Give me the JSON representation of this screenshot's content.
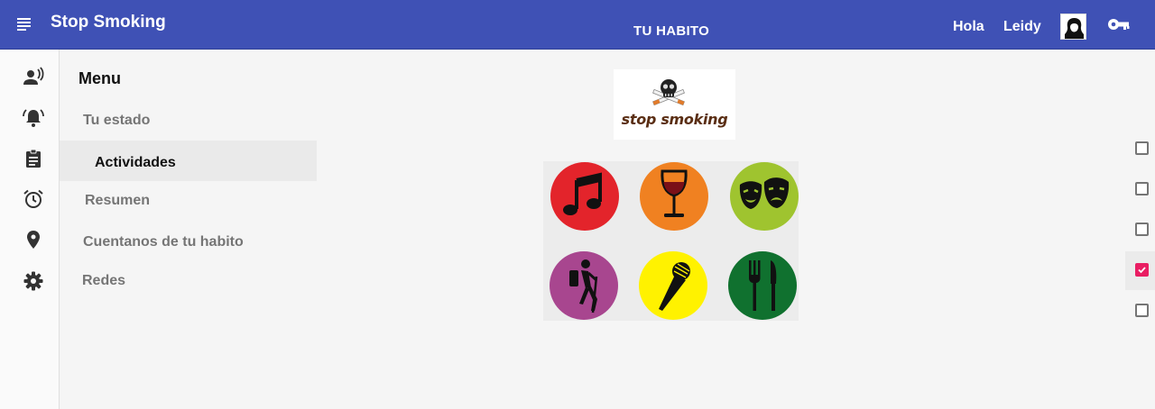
{
  "header": {
    "app_title": "Stop Smoking",
    "page_title": "TU HABITO",
    "greeting": "Hola",
    "user_name": "Leidy",
    "bar_color": "#3f51b5"
  },
  "rail": {
    "icons": [
      "person-voice-icon",
      "alarm-bell-icon",
      "clipboard-icon",
      "alarm-clock-icon",
      "location-pin-icon",
      "settings-gear-icon"
    ]
  },
  "sidebar": {
    "heading": "Menu",
    "items": [
      {
        "label": "Tu estado",
        "active": false
      },
      {
        "label": "Actividades",
        "active": true
      },
      {
        "label": "Resumen",
        "active": false
      },
      {
        "label": "Cuentanos de tu habito",
        "active": false
      },
      {
        "label": "Redes",
        "active": false
      }
    ]
  },
  "logo": {
    "text": "stop smoking",
    "icon": "skull-crossed-cigarettes-icon"
  },
  "activities": [
    {
      "name": "music-icon",
      "color": "#e3242b"
    },
    {
      "name": "wine-glass-icon",
      "color": "#f08121"
    },
    {
      "name": "theater-masks-icon",
      "color": "#9fc42f"
    },
    {
      "name": "hiking-icon",
      "color": "#a8468f"
    },
    {
      "name": "microphone-icon",
      "color": "#fff200"
    },
    {
      "name": "fork-knife-icon",
      "color": "#10712f"
    }
  ],
  "checkboxes": [
    false,
    false,
    false,
    true,
    false
  ],
  "accent_color": "#e91e63"
}
